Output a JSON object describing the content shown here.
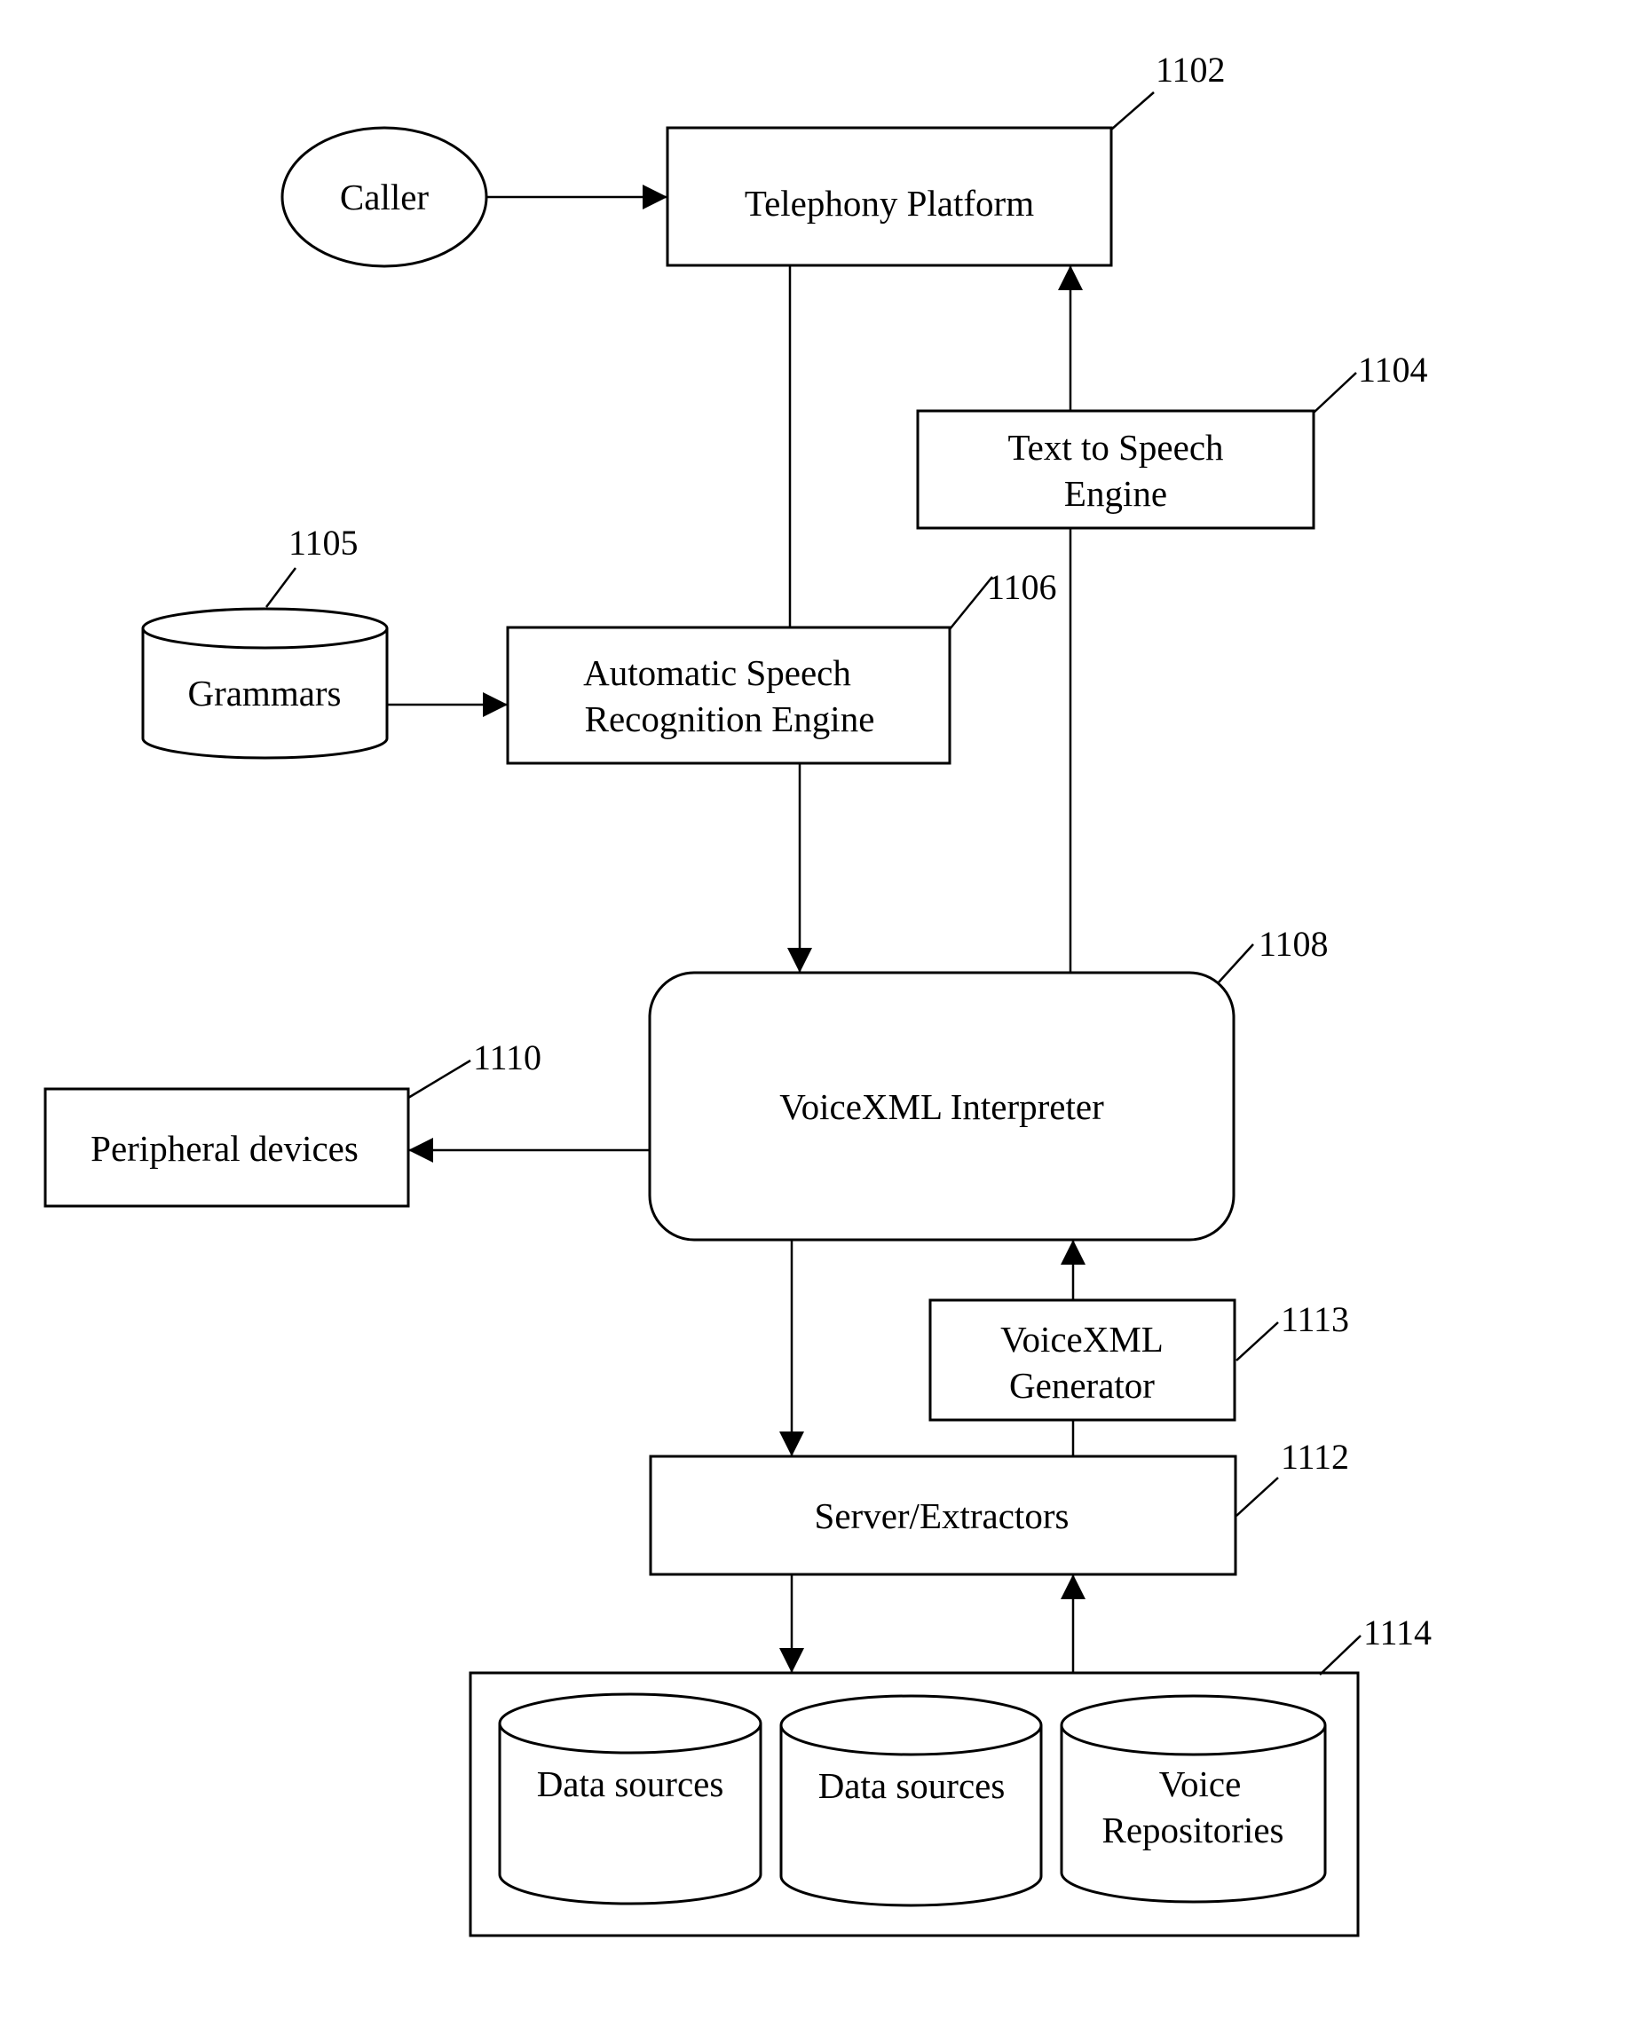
{
  "figure": {
    "nodes": {
      "caller": {
        "label": "Caller",
        "shape": "ellipse"
      },
      "telephony": {
        "label": "Telephony Platform",
        "ref": "1102"
      },
      "tts": {
        "label_lines": [
          "Text to Speech",
          "Engine"
        ],
        "ref": "1104"
      },
      "grammars": {
        "label": "Grammars",
        "ref": "1105",
        "shape": "cylinder"
      },
      "asr": {
        "label_lines": [
          "Automatic Speech",
          "Recognition Engine"
        ],
        "ref": "1106"
      },
      "interpreter": {
        "label": "VoiceXML Interpreter",
        "ref": "1108",
        "shape": "rounded-rectangle"
      },
      "peripheral": {
        "label": "Peripheral devices",
        "ref": "1110"
      },
      "generator": {
        "label_lines": [
          "VoiceXML",
          "Generator"
        ],
        "ref": "1113"
      },
      "server": {
        "label": "Server/Extractors",
        "ref": "1112"
      },
      "repositories": {
        "ref": "1114",
        "items": [
          {
            "label_lines": [
              "Data sources"
            ]
          },
          {
            "label_lines": [
              "Data sources"
            ]
          },
          {
            "label_lines": [
              "Voice",
              "Repositories"
            ]
          }
        ]
      }
    },
    "edges": [
      {
        "from": "caller",
        "to": "telephony",
        "arrow": "end"
      },
      {
        "from": "telephony",
        "to": "asr",
        "arrow": "none"
      },
      {
        "from": "tts",
        "to": "telephony",
        "arrow": "end"
      },
      {
        "from": "grammars",
        "to": "asr",
        "arrow": "end"
      },
      {
        "from": "asr",
        "to": "interpreter",
        "arrow": "end"
      },
      {
        "from": "interpreter",
        "to": "tts",
        "arrow": "none"
      },
      {
        "from": "interpreter",
        "to": "peripheral",
        "arrow": "end"
      },
      {
        "from": "interpreter",
        "to": "server",
        "arrow": "end"
      },
      {
        "from": "generator",
        "to": "interpreter",
        "arrow": "end"
      },
      {
        "from": "server",
        "to": "generator",
        "arrow": "none"
      },
      {
        "from": "server",
        "to": "repositories",
        "arrow": "end"
      },
      {
        "from": "repositories",
        "to": "server",
        "arrow": "end"
      }
    ]
  }
}
